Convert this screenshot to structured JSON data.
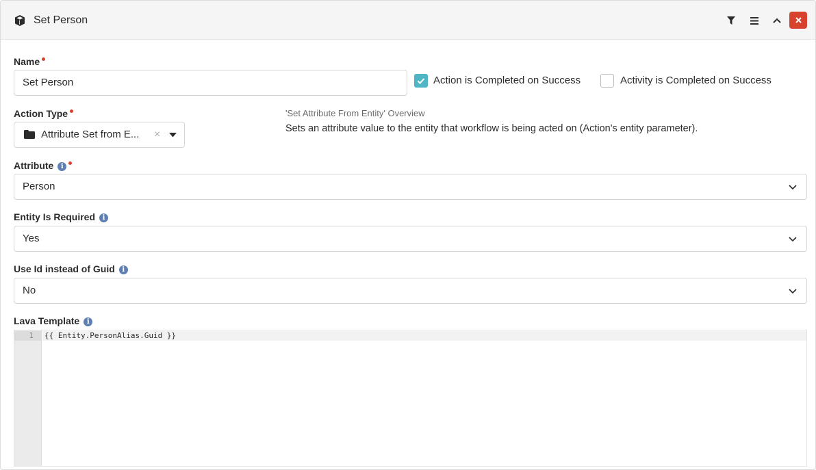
{
  "header": {
    "title": "Set Person",
    "icon": "cube-icon",
    "actions": [
      "filter-icon",
      "menu-icon",
      "chevron-up-icon",
      "close-icon"
    ],
    "close_color": "#d9412f"
  },
  "name": {
    "label": "Name",
    "required": true,
    "value": "Set Person"
  },
  "checkboxes": {
    "action_completed": {
      "label": "Action is Completed on Success",
      "checked": true,
      "color": "#50b5c4"
    },
    "activity_completed": {
      "label": "Activity is Completed on Success",
      "checked": false
    }
  },
  "action_type": {
    "label": "Action Type",
    "required": true,
    "value": "Attribute Set from E...",
    "clear_glyph": "×"
  },
  "overview": {
    "title": "'Set Attribute From Entity' Overview",
    "text": "Sets an attribute value to the entity that workflow is being acted on (Action's entity parameter)."
  },
  "attribute": {
    "label": "Attribute",
    "required": true,
    "value": "Person"
  },
  "entity_required": {
    "label": "Entity Is Required",
    "value": "Yes"
  },
  "use_id": {
    "label": "Use Id instead of Guid",
    "value": "No"
  },
  "lava_template": {
    "label": "Lava Template",
    "lines": [
      {
        "number": "1",
        "code": "{{ Entity.PersonAlias.Guid }}"
      }
    ]
  },
  "info_glyph": "i"
}
